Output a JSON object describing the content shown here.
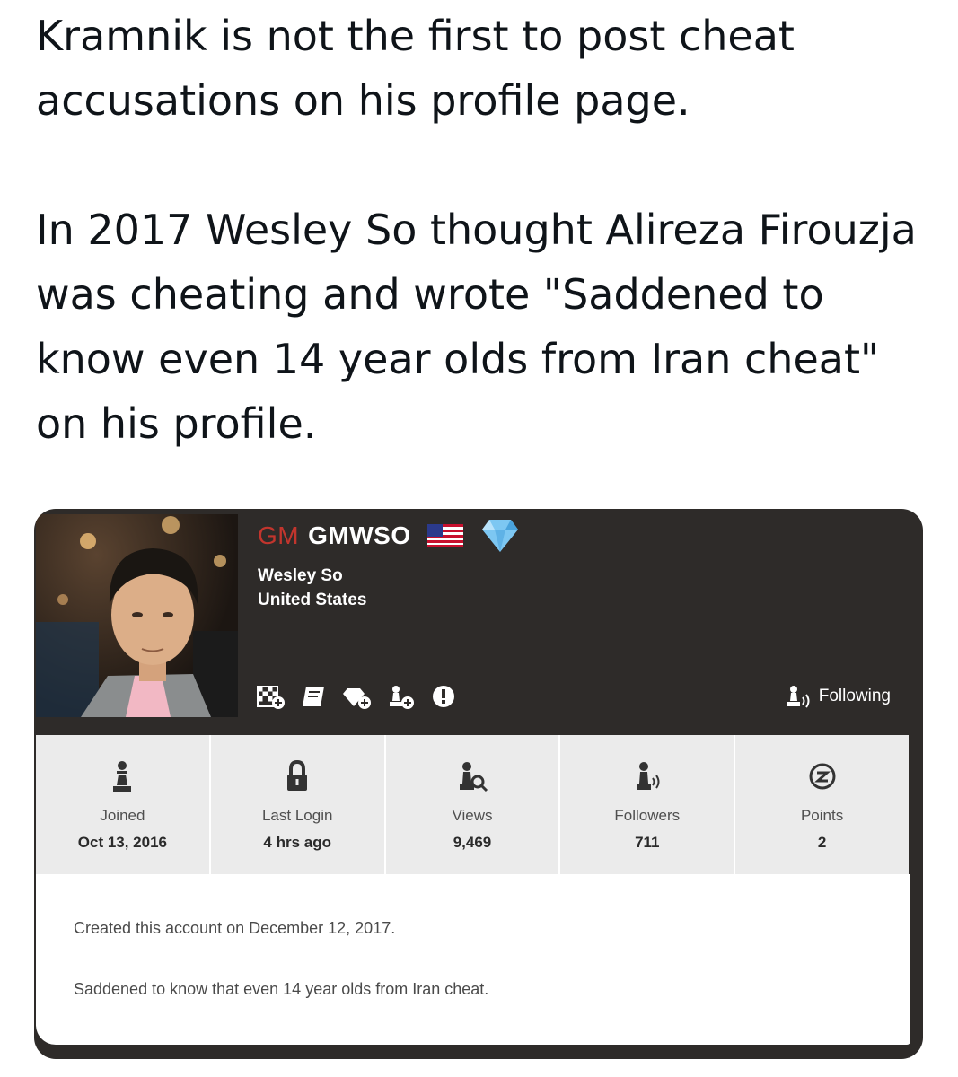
{
  "tweet": {
    "paragraph1": "Kramnik is not the first to post cheat accusations on his profile page.",
    "paragraph2": "In 2017 Wesley So thought Alireza Firouzja was cheating and wrote \"Saddened to know even 14 year olds from Iran cheat\" on his profile."
  },
  "profile": {
    "title": "GM",
    "username": "GMWSO",
    "real_name": "Wesley So",
    "country": "United States",
    "following_label": "Following",
    "badges": [
      "chessboard-plus-icon",
      "book-icon",
      "diamond-plus-icon",
      "pawn-plus-icon",
      "alert-icon"
    ],
    "stats": [
      {
        "icon": "pawn-icon",
        "label": "Joined",
        "value": "Oct 13, 2016"
      },
      {
        "icon": "lock-icon",
        "label": "Last Login",
        "value": "4 hrs ago"
      },
      {
        "icon": "views-icon",
        "label": "Views",
        "value": "9,469"
      },
      {
        "icon": "followers-icon",
        "label": "Followers",
        "value": "711"
      },
      {
        "icon": "points-icon",
        "label": "Points",
        "value": "2"
      }
    ],
    "about": {
      "line1": "Created this account on December 12, 2017.",
      "line2": "Saddened to know that even 14 year olds from Iran cheat."
    }
  },
  "colors": {
    "title_red": "#c2352d",
    "card_dark": "#2e2b29",
    "stats_bg": "#ebebeb",
    "diamond": "#7dc7f2"
  }
}
